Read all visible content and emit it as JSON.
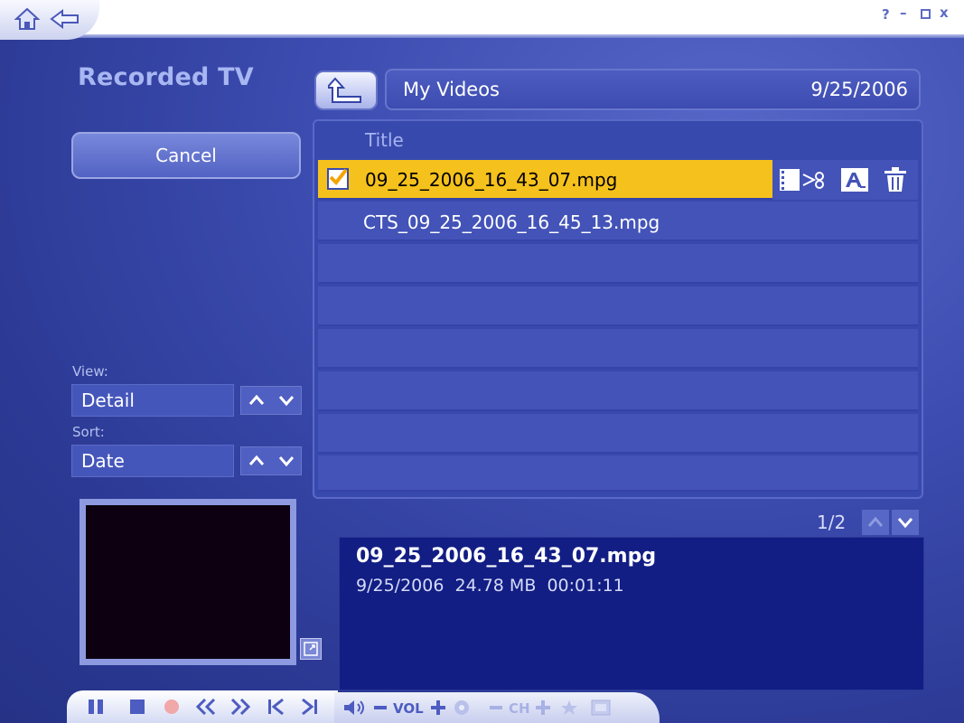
{
  "window": {
    "help_label": "?",
    "minimize_label": "–",
    "close_label": "x"
  },
  "section_title": "Recorded TV",
  "cancel_label": "Cancel",
  "path": {
    "folder": "My Videos",
    "date": "9/25/2006"
  },
  "list": {
    "column_title": "Title",
    "rows": [
      {
        "name": "09_25_2006_16_43_07.mpg",
        "selected": true,
        "checked": true
      },
      {
        "name": "CTS_09_25_2006_16_45_13.mpg",
        "selected": false,
        "checked": false
      }
    ],
    "empty_row_count": 6
  },
  "view": {
    "label": "View:",
    "value": "Detail"
  },
  "sort": {
    "label": "Sort:",
    "value": "Date"
  },
  "pager": {
    "text": "1/2"
  },
  "details": {
    "filename": "09_25_2006_16_43_07.mpg",
    "meta": "9/25/2006  24.78 MB  00:01:11"
  },
  "transport": {
    "vol_label": "VOL",
    "ch_label": "CH"
  },
  "colors": {
    "selection": "#f5c11c",
    "background": "#3c4cb0",
    "info_panel": "#121e84"
  }
}
